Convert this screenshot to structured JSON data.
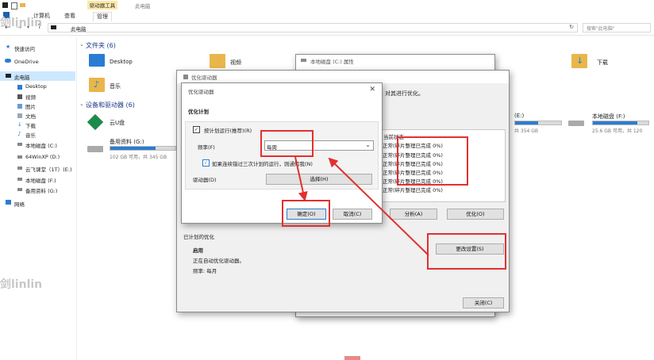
{
  "ribbon": {
    "tab_drive_tools": "驱动器工具",
    "tab_this_pc": "此电脑",
    "tab_computer": "计算机",
    "tab_view": "查看",
    "tab_manage": "管理"
  },
  "address": {
    "path": "此电脑",
    "search_placeholder": "搜索\"此电脑\""
  },
  "watermark": "剑linlin",
  "sidebar": {
    "items": [
      {
        "label": "快速访问"
      },
      {
        "label": "OneDrive"
      },
      {
        "label": "此电脑"
      },
      {
        "label": "Desktop"
      },
      {
        "label": "视频"
      },
      {
        "label": "图片"
      },
      {
        "label": "文档"
      },
      {
        "label": "下载"
      },
      {
        "label": "音乐"
      },
      {
        "label": "本地磁盘 (C:)"
      },
      {
        "label": "64WinXP  (D:)"
      },
      {
        "label": "云飞课堂（1T）(E:)"
      },
      {
        "label": "本地磁盘 (F:)"
      },
      {
        "label": "备用资料 (G:)"
      },
      {
        "label": "网络"
      }
    ]
  },
  "main": {
    "folders_header": "文件夹 (6)",
    "devices_header": "设备和驱动器 (6)",
    "folder_desktop": "Desktop",
    "folder_video": "视频",
    "folder_music": "音乐",
    "folder_download": "下载",
    "drive_cloud": "云U盘",
    "drive_g_name": "备用资料 (G:)",
    "drive_g_size": "102 GB 可用，共 345 GB",
    "drive_g_fill": 0.7,
    "drive_e_name": "(E:)",
    "drive_e_size": "共 354 GB",
    "drive_e_fill": 0.5,
    "drive_f_name": "本地磁盘 (F:)",
    "drive_f_size": "25.6 GB 可用，共 120",
    "drive_f_fill": 0.8
  },
  "props_window": {
    "title": "本地磁盘 (C:) 属性"
  },
  "optimize_window": {
    "title": "优化驱动器",
    "desc": "对其进行优化。",
    "status_header": "当前状态",
    "status_rows": [
      "正常(碎片整理已完成 0%)",
      "正常(碎片整理已完成 0%)",
      "正常(碎片整理已完成 0%)",
      "正常(碎片整理已完成 0%)",
      "正常(碎片整理已完成 0%)",
      "正常(碎片整理已完成 0%)"
    ],
    "analyze_button": "分析(A)",
    "optimize_button": "优化(O)",
    "scheduled_header": "已计划的优化",
    "scheduled_state": "启用",
    "scheduled_desc": "正在自动优化驱动器。",
    "scheduled_freq": "频率: 每月",
    "change_settings_button": "更改设置(S)",
    "close_button": "关闭(C)"
  },
  "schedule_dialog": {
    "title": "优化驱动器",
    "section": "优化计划",
    "check_run_schedule": "按计划运行(推荐)(R)",
    "freq_label": "频率(F)",
    "freq_value": "每周",
    "check_notify": "如果连续错过三次计划的运行，则通知我(N)",
    "drives_label": "驱动器(D)",
    "choose_button": "选择(H)",
    "ok_button": "确定(O)",
    "cancel_button": "取消(C)"
  }
}
